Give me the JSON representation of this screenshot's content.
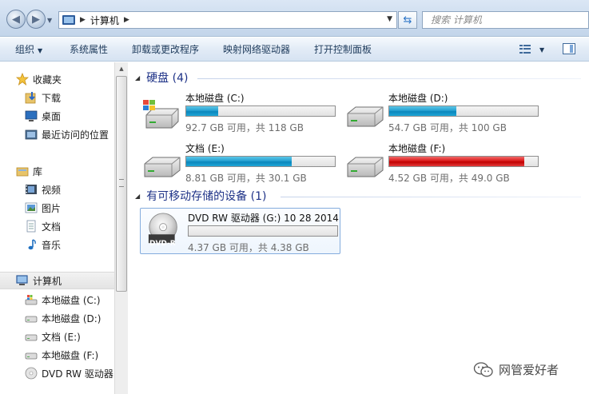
{
  "address": {
    "crumb": "计算机",
    "search_placeholder": "搜索 计算机"
  },
  "toolbar": {
    "organize": "组织",
    "system_properties": "系统属性",
    "uninstall": "卸载或更改程序",
    "map_drive": "映射网络驱动器",
    "control_panel": "打开控制面板"
  },
  "nav": {
    "favorites": "收藏夹",
    "downloads": "下载",
    "desktop": "桌面",
    "recent": "最近访问的位置",
    "libraries": "库",
    "videos": "视频",
    "pictures": "图片",
    "documents": "文档",
    "music": "音乐",
    "computer": "计算机",
    "drive_c": "本地磁盘 (C:)",
    "drive_d": "本地磁盘 (D:)",
    "drive_e": "文档 (E:)",
    "drive_f": "本地磁盘 (F:)",
    "drive_g": "DVD RW 驱动器"
  },
  "groups": {
    "hard_disks": "硬盘 (4)",
    "removable": "有可移动存储的设备 (1)"
  },
  "drives": [
    {
      "name": "本地磁盘 (C:)",
      "free": "92.7 GB 可用，共 118 GB",
      "used_fraction": 0.214,
      "color": "#1fa6d6"
    },
    {
      "name": "本地磁盘 (D:)",
      "free": "54.7 GB 可用，共 100 GB",
      "used_fraction": 0.453,
      "color": "#1fa6d6"
    },
    {
      "name": "文档 (E:)",
      "free": "8.81 GB 可用，共 30.1 GB",
      "used_fraction": 0.707,
      "color": "#1fa6d6"
    },
    {
      "name": "本地磁盘 (F:)",
      "free": "4.52 GB 可用，共 49.0 GB",
      "used_fraction": 0.908,
      "color": "#da1a1a"
    }
  ],
  "dvd": {
    "name": "DVD RW 驱动器 (G:) 10 28 2014",
    "free": "4.37 GB 可用，共 4.38 GB",
    "used_fraction": 0.002,
    "label": "DVD-R"
  },
  "watermark": "网管爱好者"
}
